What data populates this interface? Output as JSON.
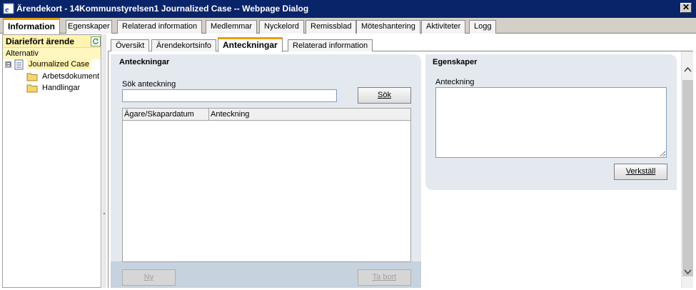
{
  "window": {
    "title": "Ärendekort - 14Kommunstyrelsen1 Journalized Case -- Webpage Dialog",
    "close_glyph": "✕"
  },
  "main_tabs": [
    {
      "label": "Information",
      "active": true
    },
    {
      "label": "Egenskaper"
    },
    {
      "label": "Relaterad information"
    },
    {
      "label": "Medlemmar"
    },
    {
      "label": "Nyckelord"
    },
    {
      "label": "Remissblad"
    },
    {
      "label": "Möteshantering"
    },
    {
      "label": "Aktiviteter"
    },
    {
      "label": "Logg"
    }
  ],
  "left_pane": {
    "header": "Diariefört ärende",
    "refresh_icon": "refresh-icon",
    "subheader": "Alternativ",
    "tree": {
      "root": {
        "label": "Journalized Case",
        "toggle": "⊟",
        "selected": true
      },
      "children": [
        {
          "label": "Arbetsdokument"
        },
        {
          "label": "Handlingar"
        }
      ]
    }
  },
  "inner_tabs": [
    {
      "label": "Översikt"
    },
    {
      "label": "Ärendekortsinfo"
    },
    {
      "label": "Anteckningar",
      "active": true
    },
    {
      "label": "Relaterad information"
    }
  ],
  "notes_panel": {
    "title": "Anteckningar",
    "search_label": "Sök anteckning",
    "search_value": "",
    "search_button": "Sök",
    "columns": [
      "Ägare/Skapardatum",
      "Anteckning"
    ],
    "rows": [],
    "new_button": "Ny",
    "delete_button": "Ta bort"
  },
  "properties_panel": {
    "title": "Egenskaper",
    "note_label": "Anteckning",
    "note_value": "",
    "apply_button": "Verkställ"
  },
  "colors": {
    "titlebar": "#0a246a",
    "active_tab_accent": "#e8a000",
    "panel_bg": "#e4e9ef",
    "header_yellow": "#fff3b0"
  }
}
